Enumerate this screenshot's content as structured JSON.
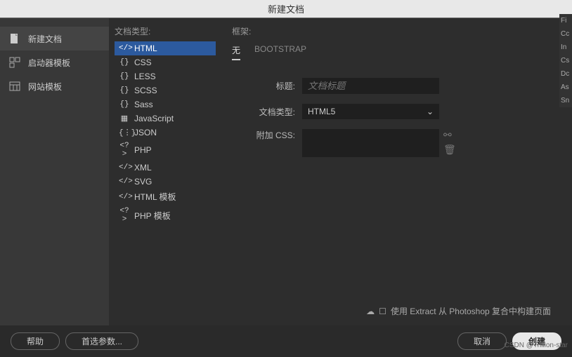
{
  "title": "新建文档",
  "sidebar": {
    "items": [
      {
        "label": "新建文档"
      },
      {
        "label": "启动器模板"
      },
      {
        "label": "网站模板"
      }
    ]
  },
  "middle": {
    "label": "文档类型:",
    "types": [
      {
        "icon": "</>",
        "label": "HTML"
      },
      {
        "icon": "{}",
        "label": "CSS"
      },
      {
        "icon": "{}",
        "label": "LESS"
      },
      {
        "icon": "{}",
        "label": "SCSS"
      },
      {
        "icon": "{}",
        "label": "Sass"
      },
      {
        "icon": "▦",
        "label": "JavaScript"
      },
      {
        "icon": "{⋮}",
        "label": "JSON"
      },
      {
        "icon": "<?>",
        "label": "PHP"
      },
      {
        "icon": "</>",
        "label": "XML"
      },
      {
        "icon": "</>",
        "label": "SVG"
      },
      {
        "icon": "</>",
        "label": "HTML 模板"
      },
      {
        "icon": "<?>",
        "label": "PHP 模板"
      }
    ]
  },
  "right": {
    "frame_label": "框架:",
    "tabs": [
      {
        "label": "无"
      },
      {
        "label": "BOOTSTRAP"
      }
    ],
    "title_label": "标题:",
    "title_placeholder": "文档标题",
    "doctype_label": "文档类型:",
    "doctype_value": "HTML5",
    "css_label": "附加 CSS:",
    "extract_text": "使用 Extract 从 Photoshop 复合中构建页面"
  },
  "footer": {
    "help": "帮助",
    "prefs": "首选参数...",
    "cancel": "取消",
    "create": "创建"
  },
  "watermark": "CSDN @Trillion-star",
  "far_right": [
    "Fi",
    "Cc",
    "In",
    "Cs",
    "Dc",
    "As",
    "Sn"
  ]
}
